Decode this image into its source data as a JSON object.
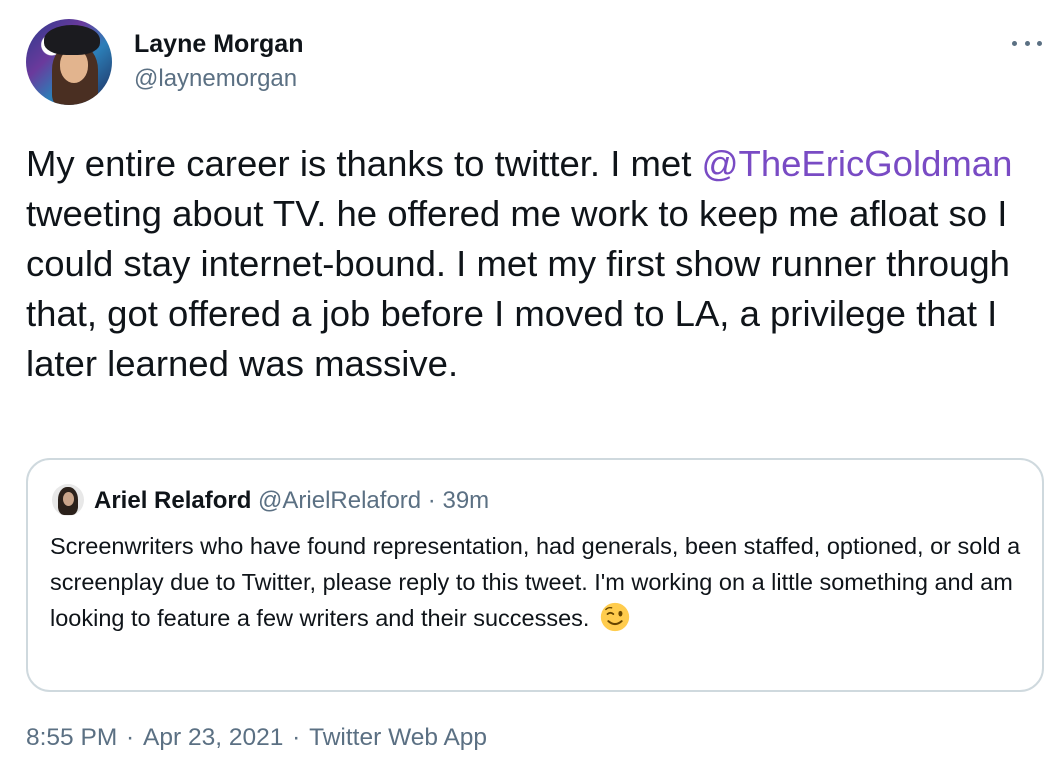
{
  "author": {
    "display_name": "Layne Morgan",
    "handle": "@laynemorgan"
  },
  "tweet": {
    "text_before": "My entire career is thanks to twitter. I met ",
    "mention": "@TheEricGoldman",
    "text_after": " tweeting about TV. he offered me work to keep me afloat so I could stay internet-bound. I met my first show runner through that, got offered a job before I moved to LA, a privilege that I later learned was massive."
  },
  "quoted_tweet": {
    "display_name": "Ariel Relaford",
    "handle": "@ArielRelaford",
    "separator": " · ",
    "time": "39m",
    "text": "Screenwriters who have found representation, had generals, been staffed, optioned, or sold a screenplay due to Twitter, please reply to this tweet. I'm working on a little something and am looking to feature a few writers and their successes.",
    "emoji": "winking-face-icon"
  },
  "footer": {
    "time": "8:55 PM",
    "separator": " · ",
    "date": "Apr 23, 2021",
    "source": "Twitter Web App"
  },
  "colors": {
    "mention": "#794bc4",
    "secondary_text": "#5b7083",
    "border": "#cfd9de"
  },
  "icons": {
    "more": "more-options-icon",
    "emoji": "winking-face-icon"
  }
}
